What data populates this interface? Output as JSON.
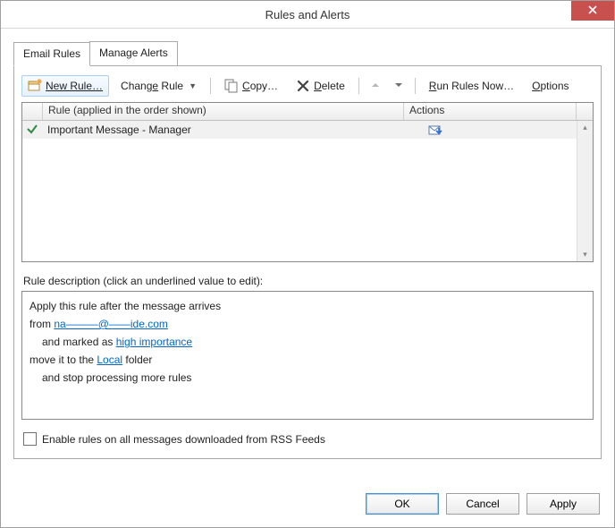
{
  "window": {
    "title": "Rules and Alerts"
  },
  "tabs": {
    "email_rules": "Email Rules",
    "manage_alerts": "Manage Alerts"
  },
  "toolbar": {
    "new_rule": "New Rule…",
    "change_rule": "Change Rule",
    "copy": "Copy…",
    "delete": "Delete",
    "run_rules": "Run Rules Now…",
    "options": "Options"
  },
  "grid": {
    "header_rule": "Rule (applied in the order shown)",
    "header_actions": "Actions",
    "rows": [
      {
        "name": "Important Message - Manager",
        "checked": true
      }
    ]
  },
  "description": {
    "label": "Rule description (click an underlined value to edit):",
    "line1": "Apply this rule after the message arrives",
    "line2_prefix": "from ",
    "line2_link": "na———@——ide.com",
    "line3_prefix": "and marked as ",
    "line3_link": "high importance",
    "line4_prefix": "move it to the ",
    "line4_link": "Local",
    "line4_suffix": " folder",
    "line5": "and stop processing more rules"
  },
  "rss": {
    "label": "Enable rules on all messages downloaded from RSS Feeds",
    "checked": false
  },
  "buttons": {
    "ok": "OK",
    "cancel": "Cancel",
    "apply": "Apply"
  }
}
